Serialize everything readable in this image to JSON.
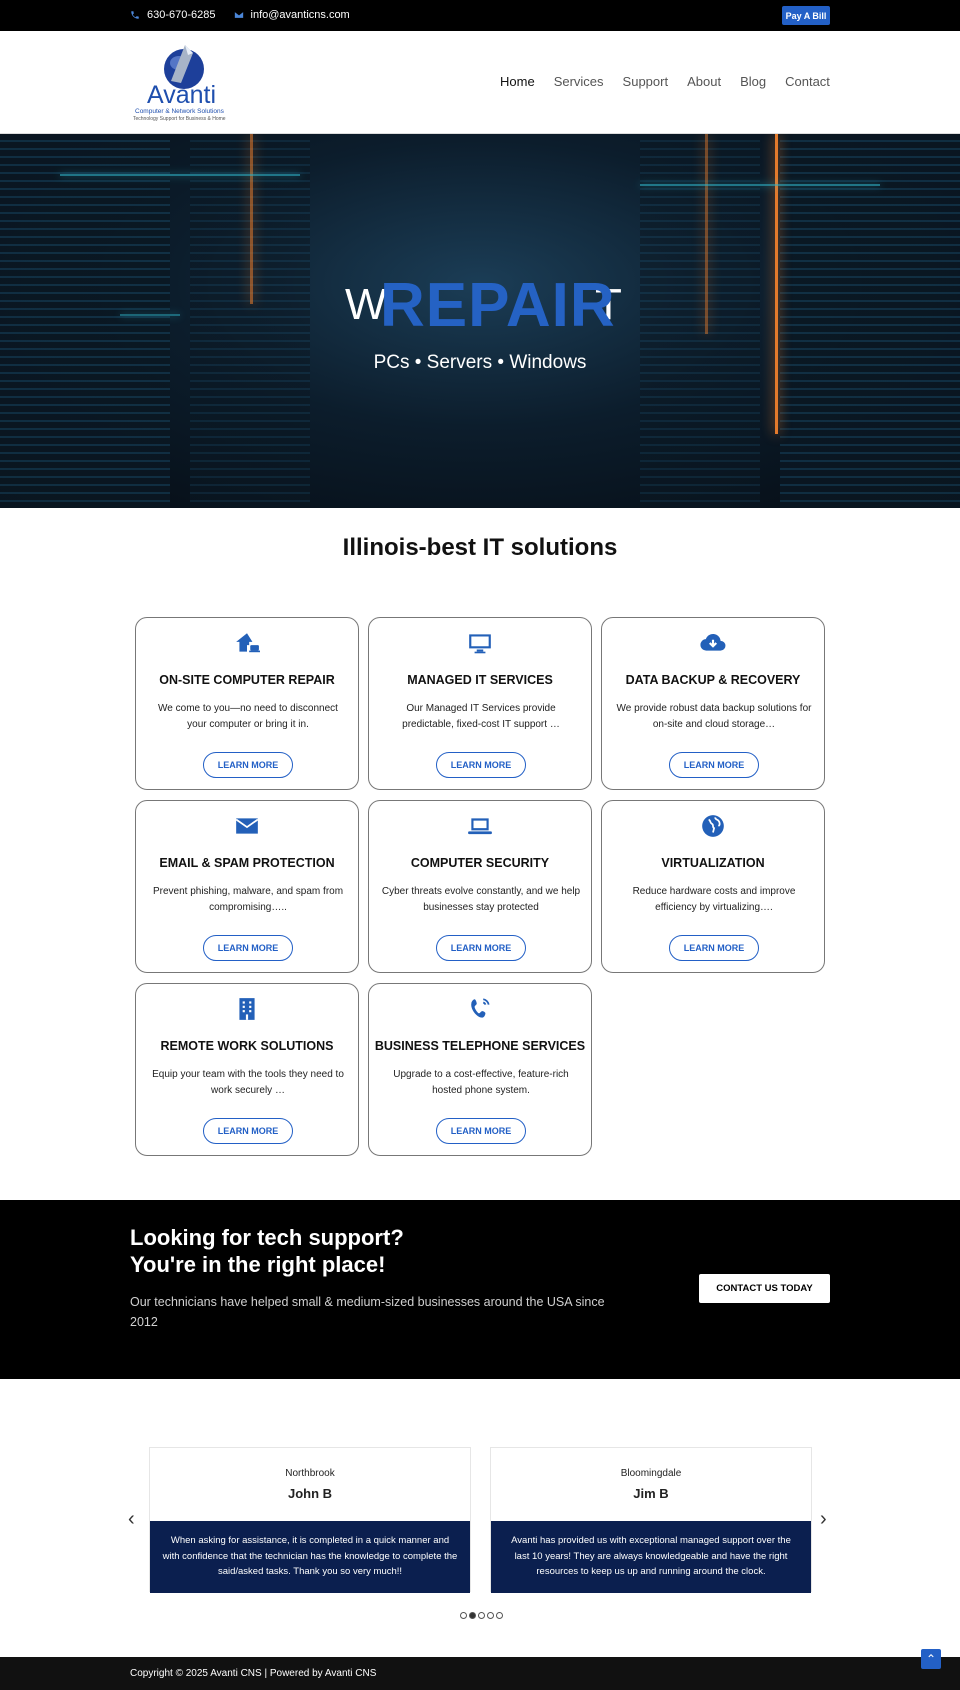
{
  "topbar": {
    "phone": "630-670-6285",
    "email": "info@avanticns.com",
    "pay_label": "Pay A Bill"
  },
  "logo": {
    "name": "Avanti",
    "line1": "Computer & Network Solutions",
    "line2": "Technology Support for Business & Home"
  },
  "nav": {
    "items": [
      "Home",
      "Services",
      "Support",
      "About",
      "Blog",
      "Contact"
    ],
    "active": "Home"
  },
  "hero": {
    "word_left": "W",
    "word_main": "REPAIR",
    "word_right": "T",
    "tagline": "PCs • Servers • Windows"
  },
  "services": {
    "title": "Illinois-best IT solutions",
    "cards": [
      {
        "icon": "house-laptop-icon",
        "title": "ON-SITE COMPUTER REPAIR",
        "desc": "We come to you—no need to disconnect your computer or bring it in.",
        "button": "LEARN MORE"
      },
      {
        "icon": "monitor-icon",
        "title": "MANAGED IT SERVICES",
        "desc": "Our Managed IT Services provide predictable, fixed-cost IT support …",
        "button": "LEARN MORE"
      },
      {
        "icon": "cloud-download-icon",
        "title": "DATA BACKUP & RECOVERY",
        "desc": "We provide robust data backup solutions for on-site and cloud storage…",
        "button": "LEARN MORE"
      },
      {
        "icon": "envelope-icon",
        "title": "EMAIL & SPAM PROTECTION",
        "desc": "Prevent phishing, malware, and spam from compromising…..",
        "button": "LEARN MORE"
      },
      {
        "icon": "laptop-icon",
        "title": "COMPUTER SECURITY",
        "desc": "Cyber threats evolve constantly, and we help businesses stay protected",
        "button": "LEARN MORE"
      },
      {
        "icon": "globe-icon",
        "title": "VIRTUALIZATION",
        "desc": "Reduce hardware costs and improve efficiency by virtualizing….",
        "button": "LEARN MORE"
      },
      {
        "icon": "building-icon",
        "title": "REMOTE WORK SOLUTIONS",
        "desc": "Equip your team with the tools they need to work securely …",
        "button": "LEARN MORE"
      },
      {
        "icon": "phone-volume-icon",
        "title": "BUSINESS TELEPHONE SERVICES",
        "desc": "Upgrade to a cost-effective, feature-rich hosted phone system.",
        "button": "LEARN MORE"
      }
    ]
  },
  "cta": {
    "heading_1": "Looking for tech support?",
    "heading_2": "You're in the right place!",
    "text": "Our technicians have helped small & medium-sized businesses around the USA since 2012",
    "button": "CONTACT US TODAY"
  },
  "testimonials": [
    {
      "location": "Northbrook",
      "name": "John B",
      "quote": "When asking for assistance, it is completed in a quick manner and with confidence that the technician has the knowledge to complete the said/asked tasks. Thank you so very much!!"
    },
    {
      "location": "Bloomingdale",
      "name": "Jim B",
      "quote": "Avanti has provided us with exceptional managed support over the last 10 years! They are always knowledgeable and have the right resources to keep us up and running around the clock."
    }
  ],
  "carousel": {
    "prev": "‹",
    "next": "›",
    "active_dot": 1
  },
  "footer": {
    "copyright": "Copyright © 2025 Avanti CNS | Powered by Avanti CNS",
    "to_top": "⌃"
  },
  "colors": {
    "accent": "#2360c6",
    "navy": "#0b1f4f",
    "black": "#000000"
  }
}
